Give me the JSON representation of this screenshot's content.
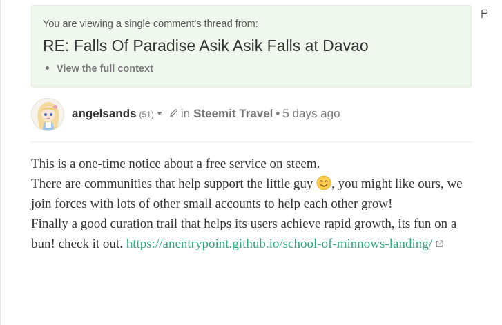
{
  "notice": {
    "intro": "You are viewing a single comment's thread from:",
    "title": "RE: Falls Of Paradise Asik Asik Falls at Davao",
    "context_link": "View the full context"
  },
  "comment": {
    "author": "angelsands",
    "reputation": "(51)",
    "in_label": "in",
    "community": "Steemit Travel",
    "separator": "•",
    "time": "5 days ago",
    "paragraph1": "This is a one-time notice about a free service on steem.",
    "paragraph2_a": "There are communities that help support the little guy",
    "paragraph2_b": ", you might like ours, we join forces with lots of other small accounts to help each other grow!",
    "paragraph3": "Finally a good curation trail that helps its users achieve rapid growth, its fun on a bun! check it out.",
    "link": "https://anentrypoint.github.io/school-of-minnows-landing/"
  },
  "colors": {
    "notice_bg": "#f0f8ee",
    "link": "#2ea77a",
    "text": "#333333",
    "muted": "#777777"
  },
  "icons": [
    "flag-icon",
    "avatar",
    "caret-down-icon",
    "pencil-icon",
    "smiling-face-emoji",
    "external-link-icon"
  ]
}
